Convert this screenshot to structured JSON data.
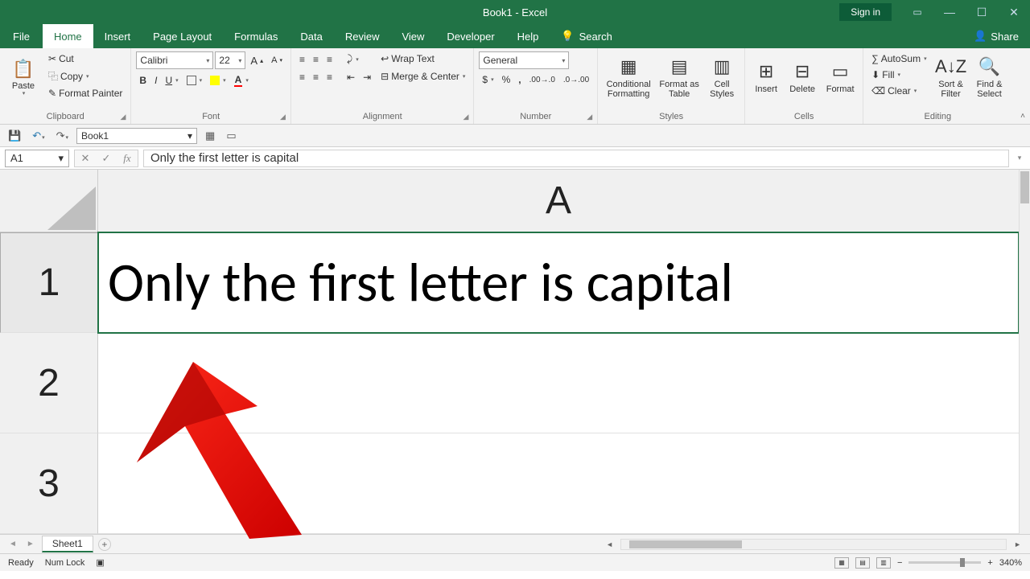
{
  "title": "Book1 - Excel",
  "signin": "Sign in",
  "tabs": {
    "file": "File",
    "home": "Home",
    "insert": "Insert",
    "pagelayout": "Page Layout",
    "formulas": "Formulas",
    "data": "Data",
    "review": "Review",
    "view": "View",
    "developer": "Developer",
    "help": "Help",
    "tellme": "Search"
  },
  "share": "Share",
  "clipboard": {
    "label": "Clipboard",
    "paste": "Paste",
    "cut": "Cut",
    "copy": "Copy",
    "fp": "Format Painter"
  },
  "font": {
    "label": "Font",
    "name": "Calibri",
    "size": "22",
    "bold": "B",
    "italic": "I",
    "underline": "U"
  },
  "alignment": {
    "label": "Alignment",
    "wrap": "Wrap Text",
    "merge": "Merge & Center"
  },
  "number": {
    "label": "Number",
    "format": "General"
  },
  "styles": {
    "label": "Styles",
    "cf": "Conditional Formatting",
    "fat": "Format as Table",
    "cs": "Cell Styles"
  },
  "cells": {
    "label": "Cells",
    "insert": "Insert",
    "delete": "Delete",
    "format": "Format"
  },
  "editing": {
    "label": "Editing",
    "autosum": "AutoSum",
    "fill": "Fill",
    "clear": "Clear",
    "sort": "Sort & Filter",
    "find": "Find & Select"
  },
  "docname": "Book1",
  "namebox": "A1",
  "formula": "Only the first letter is capital",
  "col": "A",
  "rows": [
    "1",
    "2",
    "3"
  ],
  "cell_a1": "Only the first letter is capital",
  "sheet": "Sheet1",
  "status": {
    "ready": "Ready",
    "numlock": "Num Lock",
    "zoom": "340%"
  }
}
